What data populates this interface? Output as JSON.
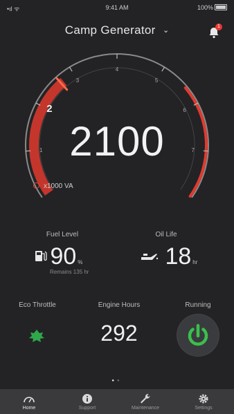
{
  "status_bar": {
    "signal": "•ıl ᯤ",
    "time": "9:41 AM",
    "battery": "100%"
  },
  "header": {
    "title": "Camp Generator",
    "chevron": "⌄",
    "notification_count": "1"
  },
  "gauge": {
    "reading": "2100",
    "unit": "x1000 VA",
    "ticks": [
      "1",
      "2",
      "3",
      "4",
      "5",
      "6",
      "7"
    ],
    "level_fraction": 0.3,
    "accent_color": "#e03a2e"
  },
  "fuel": {
    "label": "Fuel Level",
    "value": "90",
    "unit": "%",
    "remains": "Remains 135 hr",
    "icon": "fuel-pump-icon"
  },
  "oil": {
    "label": "Oil Life",
    "value": "18",
    "unit": "hr",
    "icon": "oil-can-icon"
  },
  "eco": {
    "label": "Eco Throttle",
    "icon": "leaf-icon",
    "color": "#2ea84a"
  },
  "engine_hours": {
    "label": "Engine Hours",
    "value": "292"
  },
  "running": {
    "label": "Running",
    "icon": "power-icon",
    "color": "#3bbf4c"
  },
  "tabs": [
    {
      "label": "Home",
      "icon": "speedometer-icon",
      "active": true
    },
    {
      "label": "Support",
      "icon": "info-icon",
      "active": false
    },
    {
      "label": "Maintenance",
      "icon": "wrench-icon",
      "active": false
    },
    {
      "label": "Settings",
      "icon": "gear-icon",
      "active": false
    }
  ]
}
